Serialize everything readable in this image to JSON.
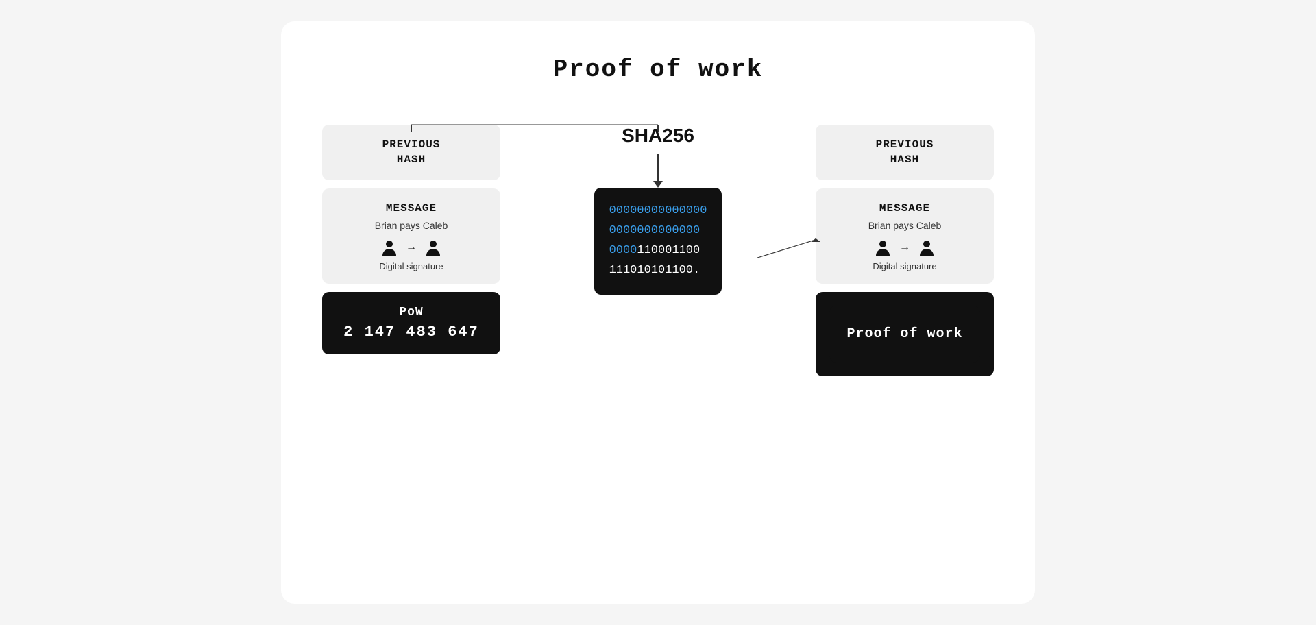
{
  "title": "Proof of work",
  "left_block": {
    "previous_hash_label": "PREVIOUS\nHASH",
    "message_title": "MESSAGE",
    "message_sub": "Brian pays Caleb",
    "digital_signature_label": "Digital signature",
    "pow_title": "PoW",
    "pow_number": "2 147 483 647"
  },
  "center": {
    "sha_label": "SHA256",
    "hash_lines": [
      {
        "text": "00000000000000",
        "color": "blue"
      },
      {
        "text": "0000000000000",
        "color": "blue"
      },
      {
        "text": "0000110001100",
        "color": "mixed"
      },
      {
        "text": "111010101100.",
        "color": "white"
      }
    ]
  },
  "right_block": {
    "previous_hash_label": "PREVIOUS\nHASH",
    "message_title": "MESSAGE",
    "message_sub": "Brian pays Caleb",
    "digital_signature_label": "Digital signature",
    "proof_of_work_label": "Proof of work"
  }
}
